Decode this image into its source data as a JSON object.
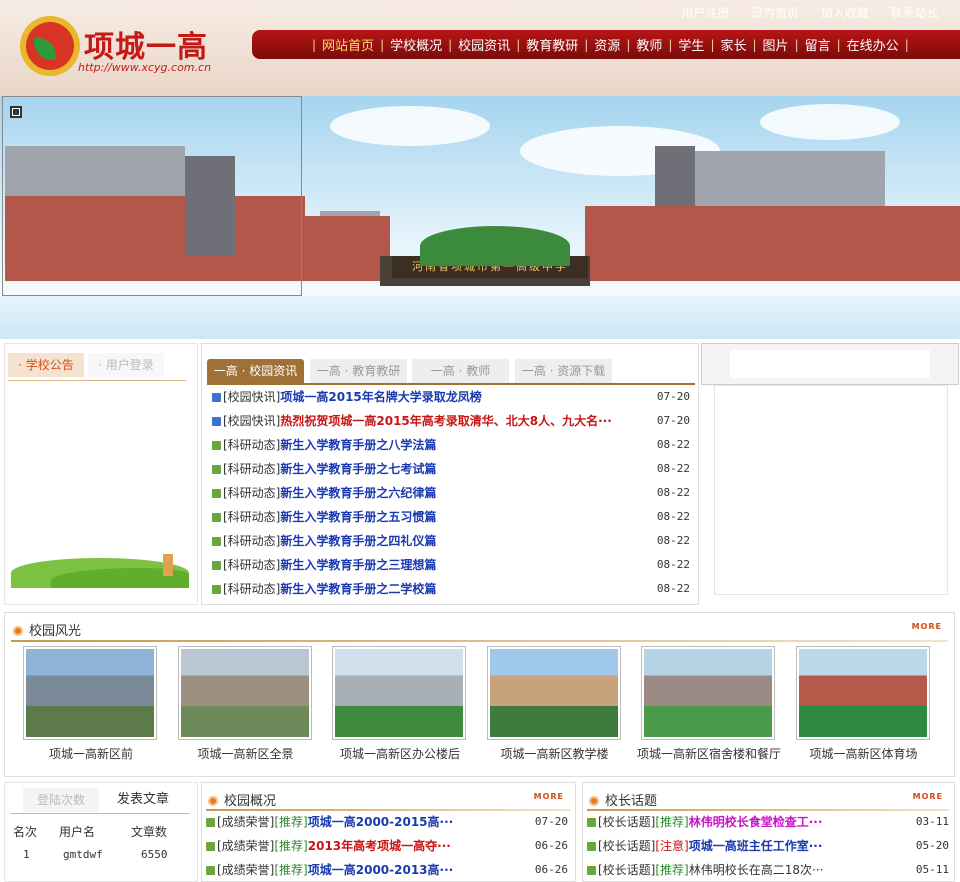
{
  "header": {
    "logo_title": "项城一高",
    "logo_url": "http://www.xcyg.com.cn",
    "toplinks": [
      "用户注册",
      "设为首页",
      "加入收藏",
      "联系站长"
    ],
    "nav": [
      "网站首页",
      "学校概况",
      "校园资讯",
      "教育教研",
      "资源",
      "教师",
      "学生",
      "家长",
      "图片",
      "留言",
      "在线办公"
    ]
  },
  "banner": {
    "gate_sign": "河南省项城市第一高级中学"
  },
  "left_panel": {
    "tab_notice": "· 学校公告",
    "tab_login": "· 用户登录"
  },
  "center_panel": {
    "tabs": [
      "一高 · 校园资讯",
      "一高 · 教育教研",
      "一高 · 教师",
      "一高 · 资源下载"
    ],
    "news": [
      {
        "cat": "[校园快讯]",
        "title": "项城一高2015年名牌大学录取龙凤榜",
        "date": "07-20",
        "style": "blue",
        "icon": "blue"
      },
      {
        "cat": "[校园快讯]",
        "title": "热烈祝贺项城一高2015年高考录取清华、北大8人、九大名···",
        "date": "07-20",
        "style": "red",
        "icon": "blue"
      },
      {
        "cat": "[科研动态]",
        "title": "新生入学教育手册之八学法篇",
        "date": "08-22",
        "style": "blue",
        "icon": "green"
      },
      {
        "cat": "[科研动态]",
        "title": "新生入学教育手册之七考试篇",
        "date": "08-22",
        "style": "blue",
        "icon": "green"
      },
      {
        "cat": "[科研动态]",
        "title": "新生入学教育手册之六纪律篇",
        "date": "08-22",
        "style": "blue",
        "icon": "green"
      },
      {
        "cat": "[科研动态]",
        "title": "新生入学教育手册之五习惯篇",
        "date": "08-22",
        "style": "blue",
        "icon": "green"
      },
      {
        "cat": "[科研动态]",
        "title": "新生入学教育手册之四礼仪篇",
        "date": "08-22",
        "style": "blue",
        "icon": "green"
      },
      {
        "cat": "[科研动态]",
        "title": "新生入学教育手册之三理想篇",
        "date": "08-22",
        "style": "blue",
        "icon": "green"
      },
      {
        "cat": "[科研动态]",
        "title": "新生入学教育手册之二学校篇",
        "date": "08-22",
        "style": "blue",
        "icon": "green"
      }
    ]
  },
  "gallery": {
    "title": "校园风光",
    "more": "MORE",
    "items": [
      "项城一高新区前",
      "项城一高新区全景",
      "项城一高新区办公楼后",
      "项城一高新区教学楼",
      "项城一高新区宿舍楼和餐厅",
      "项城一高新区体育场"
    ]
  },
  "ranking": {
    "tab_login_count": "登陆次数",
    "tab_articles": "发表文章",
    "headers": [
      "名次",
      "用户名",
      "文章数"
    ],
    "rows": [
      {
        "rank": "1",
        "user": "gmtdwf",
        "count": "6550"
      }
    ]
  },
  "overview": {
    "title": "校园概况",
    "more": "MORE",
    "rows": [
      {
        "cat": "[成绩荣誉]",
        "tag": "[推荐]",
        "title": "项城一高2000-2015高···",
        "date": "07-20",
        "style": "blue"
      },
      {
        "cat": "[成绩荣誉]",
        "tag": "[推荐]",
        "title": "2013年高考项城一高夺···",
        "date": "06-26",
        "style": "red"
      },
      {
        "cat": "[成绩荣誉]",
        "tag": "[推荐]",
        "title": "项城一高2000-2013高···",
        "date": "06-26",
        "style": "blue"
      }
    ]
  },
  "principal": {
    "title": "校长话题",
    "more": "MORE",
    "rows": [
      {
        "cat": "[校长话题]",
        "tag": "[推荐]",
        "title": "林伟明校长食堂检查工···",
        "date": "03-11",
        "style": "mag",
        "tagstyle": "green"
      },
      {
        "cat": "[校长话题]",
        "tag": "[注意]",
        "title": "项城一高班主任工作室···",
        "date": "05-20",
        "style": "blue",
        "tagstyle": "red"
      },
      {
        "cat": "[校长话题]",
        "tag": "[推荐]",
        "title": "林伟明校长在高二18次···",
        "date": "05-11",
        "style": "plain",
        "tagstyle": "green"
      }
    ]
  },
  "colors": {
    "nav_red": "#a31111",
    "accent_orange": "#e47b20",
    "title_blue": "#1a3ab0",
    "title_red": "#c81414"
  }
}
